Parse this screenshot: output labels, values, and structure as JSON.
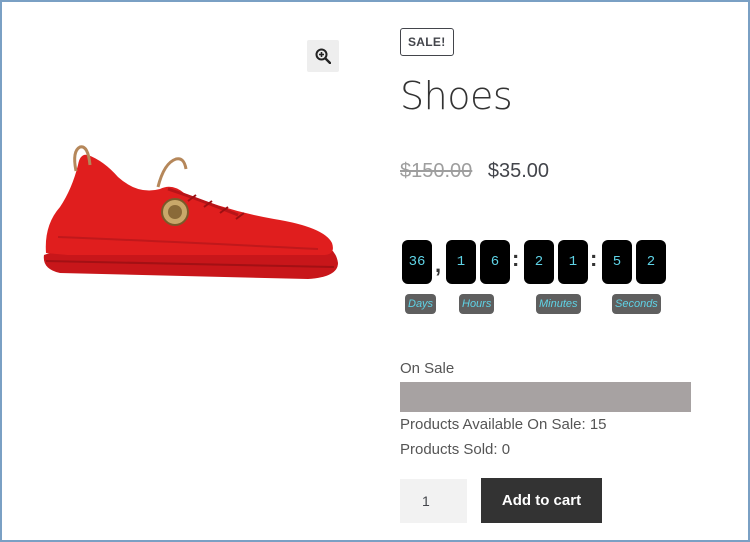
{
  "product": {
    "badge": "SALE!",
    "title": "Shoes",
    "regular_price": "$150.00",
    "sale_price": "$35.00"
  },
  "gallery": {
    "zoom_icon": "zoom-in-icon",
    "image_alt": "red sneaker"
  },
  "countdown": {
    "days": [
      "36"
    ],
    "hours": [
      "1",
      "6"
    ],
    "minutes": [
      "2",
      "1"
    ],
    "seconds": [
      "5",
      "2"
    ],
    "separator_days": ",",
    "separator_time": ":",
    "labels": {
      "days": "Days",
      "hours": "Hours",
      "minutes": "Minutes",
      "seconds": "Seconds"
    }
  },
  "sale": {
    "label": "On Sale",
    "available_text": "Products Available On Sale: 15",
    "sold_text": "Products Sold: 0",
    "sold_fraction": 0
  },
  "cart": {
    "quantity": "1",
    "add_label": "Add to cart"
  },
  "colors": {
    "frame": "#7aa0c4",
    "digit_bg": "#000000",
    "digit_text": "#5fd3e6",
    "label_bg": "#5f5f5f",
    "progress_bg": "#a7a2a2",
    "button_bg": "#333333",
    "shoe": "#e01e1e"
  }
}
